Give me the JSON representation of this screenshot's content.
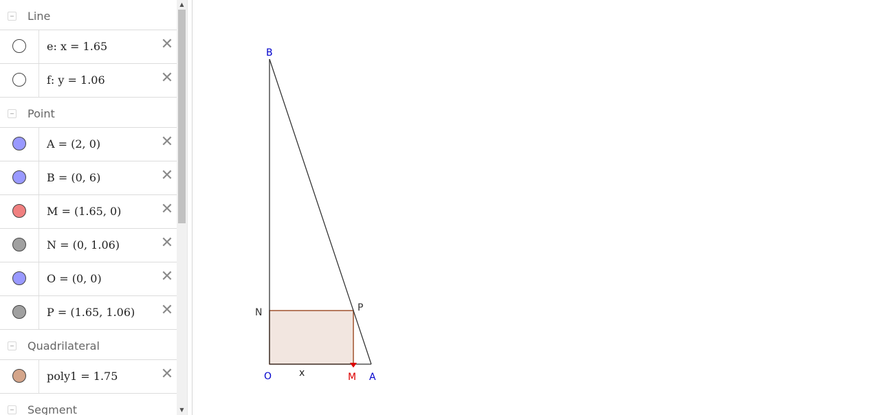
{
  "algebra": {
    "groups": [
      {
        "header": "Line",
        "items": [
          {
            "text": "e: x = 1.65",
            "marble": "#ffffff"
          },
          {
            "text": "f: y = 1.06",
            "marble": "#ffffff"
          }
        ]
      },
      {
        "header": "Point",
        "items": [
          {
            "text": "A = (2, 0)",
            "marble": "#9999ff"
          },
          {
            "text": "B = (0, 6)",
            "marble": "#9999ff"
          },
          {
            "text": "M = (1.65, 0)",
            "marble": "#f08080"
          },
          {
            "text": "N = (0, 1.06)",
            "marble": "#a0a0a0"
          },
          {
            "text": "O = (0, 0)",
            "marble": "#9999ff"
          },
          {
            "text": "P = (1.65, 1.06)",
            "marble": "#a0a0a0"
          }
        ]
      },
      {
        "header": "Quadrilateral",
        "items": [
          {
            "text": "poly1 = 1.75",
            "marble": "#d4a58a"
          }
        ]
      },
      {
        "header": "Segment",
        "items": []
      }
    ],
    "delete_glyph": "✕"
  },
  "graphics": {
    "labels": {
      "A": "A",
      "B": "B",
      "O": "O",
      "M": "M",
      "N": "N",
      "P": "P",
      "x": "x"
    },
    "colors": {
      "point_blue": "#0000cc",
      "point_red": "#dd0000",
      "label_dark": "#333333",
      "poly_fill": "#f2e6e0",
      "poly_stroke": "#a0522d"
    }
  }
}
